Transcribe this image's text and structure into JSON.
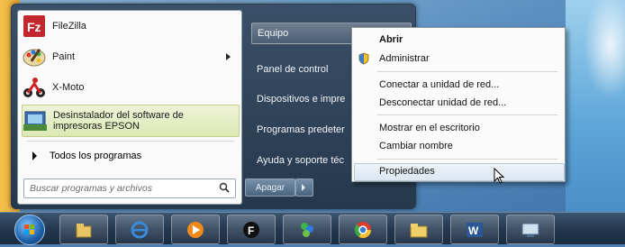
{
  "start_menu": {
    "programs": [
      {
        "label": "FileZilla",
        "icon": "filezilla-icon"
      },
      {
        "label": "Paint",
        "icon": "paint-icon",
        "has_submenu": true
      },
      {
        "label": "X-Moto",
        "icon": "xmoto-icon"
      },
      {
        "label": "Desinstalador del software de impresoras EPSON",
        "icon": "epson-uninstaller-icon",
        "selected": true
      }
    ],
    "all_programs": "Todos los programas",
    "search_placeholder": "Buscar programas y archivos",
    "right_items": [
      {
        "label": "Equipo",
        "highlighted": true
      },
      {
        "label": "Panel de control"
      },
      {
        "label": "Dispositivos e impre"
      },
      {
        "label": "Programas predeter"
      },
      {
        "label": "Ayuda y soporte téc"
      }
    ],
    "shutdown_label": "Apagar"
  },
  "context_menu": {
    "items": [
      {
        "label": "Abrir",
        "bold": true
      },
      {
        "label": "Administrar",
        "icon": "shield-icon"
      },
      {
        "label": "Conectar a unidad de red..."
      },
      {
        "label": "Desconectar unidad de red..."
      },
      {
        "label": "Mostrar en el escritorio"
      },
      {
        "label": "Cambiar nombre"
      },
      {
        "label": "Propiedades",
        "selected": true
      }
    ]
  },
  "taskbar": {
    "items": [
      "start-orb",
      "explorer-icon",
      "internet-explorer-icon",
      "media-player-icon",
      "dark-app-icon",
      "messenger-icon",
      "chrome-icon",
      "folder-icon",
      "word-icon",
      "screen-app-icon"
    ]
  }
}
